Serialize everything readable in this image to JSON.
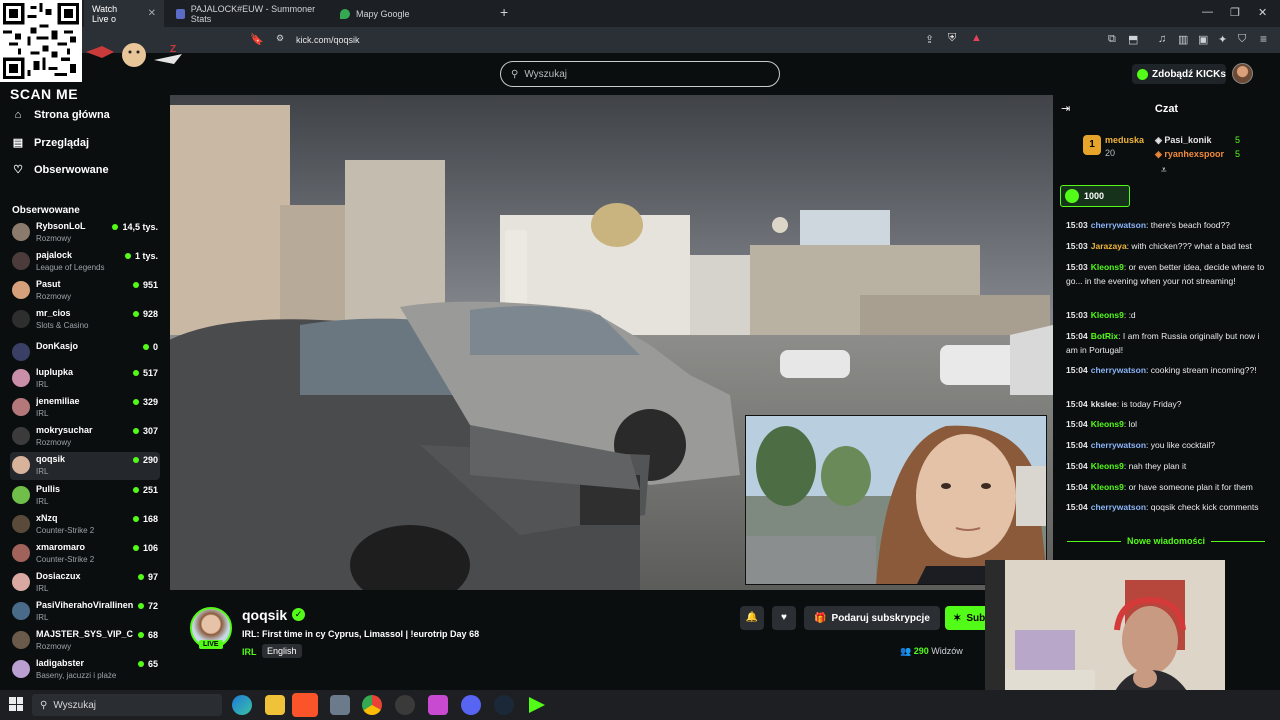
{
  "browser": {
    "tabs": [
      {
        "label": "Watch Live o",
        "active": true
      },
      {
        "label": "PAJALOCK#EUW - Summoner Stats",
        "active": false
      },
      {
        "label": "Mapy Google",
        "active": false
      }
    ],
    "url": "kick.com/qoqsik"
  },
  "overlay": {
    "scan_label": "SCAN ME"
  },
  "header": {
    "search_placeholder": "Wyszukaj",
    "kicks_label": "Zdobądź KICKs"
  },
  "sidebar": {
    "nav": [
      {
        "label": "Strona główna",
        "icon": "home-icon"
      },
      {
        "label": "Przeglądaj",
        "icon": "browse-icon"
      },
      {
        "label": "Obserwowane",
        "icon": "heart-icon"
      }
    ],
    "followed_header": "Obserwowane",
    "channels": [
      {
        "name": "RybsonLoL",
        "category": "Rozmowy",
        "viewers": "14,5 tys.",
        "color": "#8a7b6d"
      },
      {
        "name": "pajalock",
        "category": "League of Legends",
        "viewers": "1 tys.",
        "color": "#4b3b3b"
      },
      {
        "name": "Pasut",
        "category": "Rozmowy",
        "viewers": "951",
        "color": "#d6a07a"
      },
      {
        "name": "mr_cios",
        "category": "Slots & Casino",
        "viewers": "928",
        "color": "#2e2e2e"
      },
      {
        "name": "DonKasjo",
        "category": "",
        "viewers": "0",
        "color": "#3a3f66"
      },
      {
        "name": "luplupka",
        "category": "IRL",
        "viewers": "517",
        "color": "#c98fa8"
      },
      {
        "name": "jenemiliae",
        "category": "IRL",
        "viewers": "329",
        "color": "#b5787a"
      },
      {
        "name": "mokrysuchar",
        "category": "Rozmowy",
        "viewers": "307",
        "color": "#3b3b3b"
      },
      {
        "name": "qoqsik",
        "category": "IRL",
        "viewers": "290",
        "color": "#d8b29a"
      },
      {
        "name": "Pullis",
        "category": "IRL",
        "viewers": "251",
        "color": "#6fbf4a"
      },
      {
        "name": "xNzq",
        "category": "Counter-Strike 2",
        "viewers": "168",
        "color": "#5a4a3a"
      },
      {
        "name": "xmaromaro",
        "category": "Counter-Strike 2",
        "viewers": "106",
        "color": "#a0625a"
      },
      {
        "name": "Dosiaczux",
        "category": "IRL",
        "viewers": "97",
        "color": "#d9a8a0"
      },
      {
        "name": "PasiViherahoVirallinen",
        "category": "IRL",
        "viewers": "72",
        "color": "#4a6a8a"
      },
      {
        "name": "MAJSTER_SYS_VIP_C",
        "category": "Rozmowy",
        "viewers": "68",
        "color": "#6a5a4a"
      },
      {
        "name": "ladigabster",
        "category": "Baseny, jacuzzi i plaże",
        "viewers": "65",
        "color": "#b9a0d0"
      }
    ]
  },
  "stream": {
    "channel": "qoqsik",
    "live_badge": "LIVE",
    "title": "IRL: First time in cy Cyprus, Limassol | !eurotrip Day 68",
    "category": "IRL",
    "language": "English",
    "gift_label": "Podaruj subskrypcje",
    "sub_label": "Sub",
    "viewers": "290",
    "viewers_label": "Widzów"
  },
  "chat": {
    "title": "Czat",
    "leaderboard": {
      "first": {
        "rank": "1",
        "name": "meduska",
        "count": "20"
      },
      "others": [
        {
          "name": "Pasi_konik",
          "count": "5"
        },
        {
          "name": "ryanhexspoor",
          "count": "5"
        }
      ]
    },
    "goal_value": "1000",
    "messages": [
      {
        "time": "15:03",
        "user": "cherrywatson",
        "color": "#8ab4f8",
        "text": "there's beach food??"
      },
      {
        "time": "15:03",
        "user": "Jarazaya",
        "color": "#f0b43c",
        "text": "with chicken??? what a bad test"
      },
      {
        "time": "15:03",
        "user": "Kleons9",
        "color": "#53fc18",
        "text": "or even better idea, decide where to go... in the evening when your not streaming!"
      },
      {
        "time": "15:03",
        "user": "Kleons9",
        "color": "#53fc18",
        "text": ":d"
      },
      {
        "time": "15:04",
        "user": "BotRix",
        "color": "#53fc18",
        "text": "I am from Russia originally but now i am in Portugal!"
      },
      {
        "time": "15:04",
        "user": "cherrywatson",
        "color": "#8ab4f8",
        "text": "cooking stream incoming??!"
      },
      {
        "time": "15:04",
        "user": "kkslee",
        "color": "#e6e6e6",
        "text": "is today Friday?"
      },
      {
        "time": "15:04",
        "user": "Kleons9",
        "color": "#53fc18",
        "text": "lol"
      },
      {
        "time": "15:04",
        "user": "cherrywatson",
        "color": "#8ab4f8",
        "text": "you like cocktail?"
      },
      {
        "time": "15:04",
        "user": "Kleons9",
        "color": "#53fc18",
        "text": "nah they plan it"
      },
      {
        "time": "15:04",
        "user": "Kleons9",
        "color": "#53fc18",
        "text": "or have someone plan it for them"
      },
      {
        "time": "15:04",
        "user": "cherrywatson",
        "color": "#8ab4f8",
        "text": "qoqsik check kick comments"
      }
    ],
    "new_messages_label": "Nowe wiadomości"
  },
  "taskbar": {
    "search_placeholder": "Wyszukaj"
  },
  "colors": {
    "accent": "#53fc18",
    "background": "#0b0e0f"
  }
}
